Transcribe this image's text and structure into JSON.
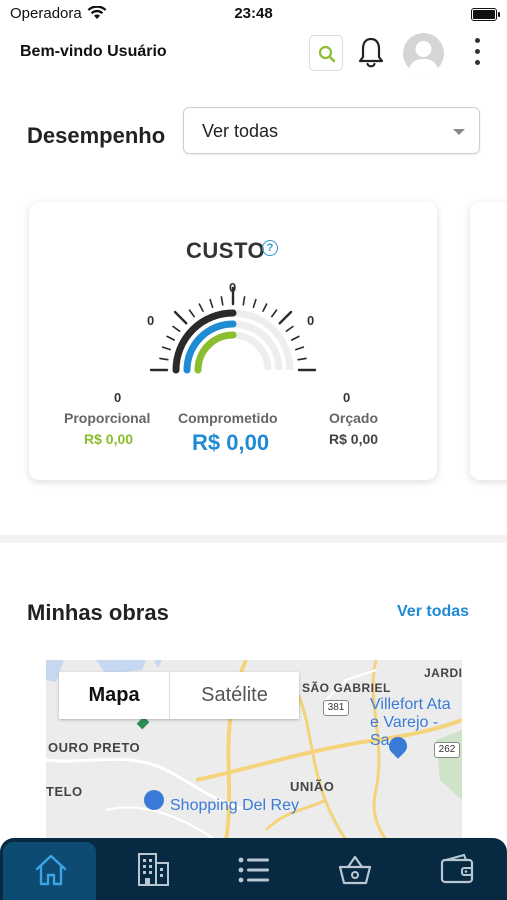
{
  "status_bar": {
    "carrier": "Operadora",
    "time": "23:48"
  },
  "header": {
    "welcome": "Bem-vindo Usuário"
  },
  "performance": {
    "title": "Desempenho",
    "filter": {
      "selected": "Ver todas"
    },
    "card": {
      "title": "CUSTO",
      "help": "?",
      "gauge_labels": [
        "0",
        "0",
        "0",
        "0",
        "0"
      ],
      "proporcional": {
        "label": "Proporcional",
        "value": "R$ 0,00"
      },
      "comprometido": {
        "label": "Comprometido",
        "value": "R$ 0,00"
      },
      "orcado": {
        "label": "Orçado",
        "value": "R$ 0,00"
      }
    }
  },
  "works": {
    "title": "Minhas obras",
    "view_all": "Ver todas",
    "map": {
      "tab_map": "Mapa",
      "tab_satellite": "Satélite",
      "labels": {
        "sao_gabriel": "SÃO GABRIEL",
        "jardim": "JARDI",
        "road_381": "381",
        "road_262": "262",
        "villefort_1": "Villefort Ata",
        "villefort_2": "e Varejo - Sa",
        "ouro_preto": "OURO PRETO",
        "uniao": "UNIÃO",
        "telo": "TELO",
        "shopping": "Shopping Del Rey"
      }
    }
  },
  "colors": {
    "accent_blue": "#1f8bd2",
    "accent_green": "#8bbd2e",
    "nav_bg": "#072a42"
  },
  "tabbar": {
    "icons": [
      "home-icon",
      "building-icon",
      "list-icon",
      "basket-icon",
      "wallet-icon"
    ],
    "active": "home-icon"
  }
}
